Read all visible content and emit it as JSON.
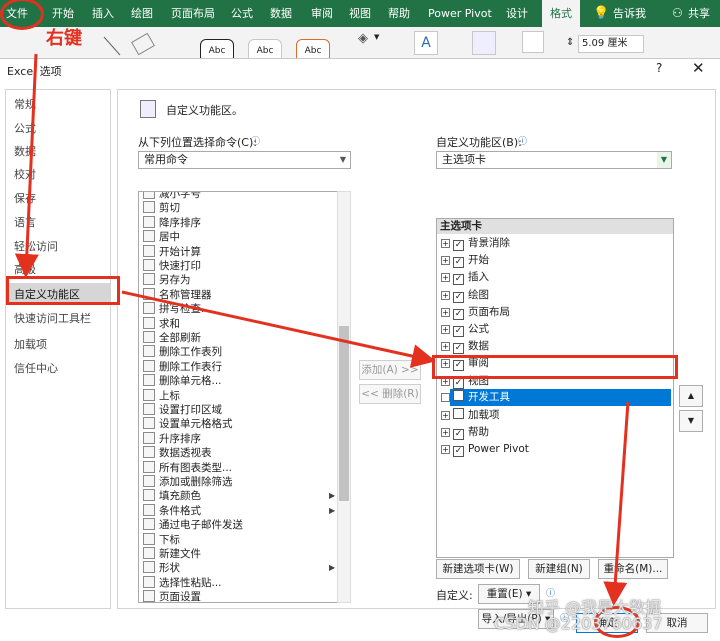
{
  "ribbon": {
    "tabs": [
      "文件",
      "开始",
      "插入",
      "绘图",
      "页面布局",
      "公式",
      "数据",
      "审阅",
      "视图",
      "帮助",
      "Power Pivot",
      "设计",
      "格式"
    ],
    "active_tab": "格式",
    "tell_me": "告诉我",
    "share": "共享",
    "size_value": "5.09 厘米",
    "shape_style_label": "Abc"
  },
  "annotation": {
    "right_click_label": "右键"
  },
  "dialog": {
    "title": "Excel 选项",
    "help": "?",
    "close": "✕",
    "nav": [
      "常规",
      "公式",
      "数据",
      "校对",
      "保存",
      "语言",
      "轻松访问",
      "高级",
      "自定义功能区",
      "快速访问工具栏",
      "加载项",
      "信任中心"
    ],
    "selected_nav": "自定义功能区",
    "header_title": "自定义功能区。",
    "from_label": "从下列位置选择命令(C):",
    "from_value": "常用命令",
    "customize_label": "自定义功能区(B):",
    "customize_value": "主选项卡",
    "commands": [
      {
        "label": "减小字号",
        "arrow": false
      },
      {
        "label": "剪切",
        "arrow": false
      },
      {
        "label": "降序排序",
        "arrow": false
      },
      {
        "label": "居中",
        "arrow": false
      },
      {
        "label": "开始计算",
        "arrow": false
      },
      {
        "label": "快速打印",
        "arrow": false
      },
      {
        "label": "另存为",
        "arrow": false
      },
      {
        "label": "名称管理器",
        "arrow": false
      },
      {
        "label": "拼写检查...",
        "arrow": false
      },
      {
        "label": "求和",
        "arrow": false
      },
      {
        "label": "全部刷新",
        "arrow": false
      },
      {
        "label": "删除工作表列",
        "arrow": false
      },
      {
        "label": "删除工作表行",
        "arrow": false
      },
      {
        "label": "删除单元格...",
        "arrow": false
      },
      {
        "label": "上标",
        "arrow": false
      },
      {
        "label": "设置打印区域",
        "arrow": false
      },
      {
        "label": "设置单元格格式",
        "arrow": false
      },
      {
        "label": "升序排序",
        "arrow": false
      },
      {
        "label": "数据透视表",
        "arrow": false
      },
      {
        "label": "所有图表类型...",
        "arrow": false
      },
      {
        "label": "添加或删除筛选",
        "arrow": false
      },
      {
        "label": "填充颜色",
        "arrow": true
      },
      {
        "label": "条件格式",
        "arrow": true
      },
      {
        "label": "通过电子邮件发送",
        "arrow": false
      },
      {
        "label": "下标",
        "arrow": false
      },
      {
        "label": "新建文件",
        "arrow": false
      },
      {
        "label": "形状",
        "arrow": true
      },
      {
        "label": "选择性粘贴...",
        "arrow": false
      },
      {
        "label": "页面设置",
        "arrow": false
      }
    ],
    "add_button": "添加(A) >>",
    "remove_button": "<< 删除(R)",
    "tree_header": "主选项卡",
    "tree": [
      {
        "label": "背景消除",
        "checked": true
      },
      {
        "label": "开始",
        "checked": true
      },
      {
        "label": "插入",
        "checked": true
      },
      {
        "label": "绘图",
        "checked": true
      },
      {
        "label": "页面布局",
        "checked": true
      },
      {
        "label": "公式",
        "checked": true
      },
      {
        "label": "数据",
        "checked": true
      },
      {
        "label": "审阅",
        "checked": true
      },
      {
        "label": "视图",
        "checked": true
      },
      {
        "label": "开发工具",
        "checked": false
      },
      {
        "label": "加载项",
        "checked": false
      },
      {
        "label": "帮助",
        "checked": true
      },
      {
        "label": "Power Pivot",
        "checked": true
      }
    ],
    "selected_tree_item": "开发工具",
    "new_tab_button": "新建选项卡(W)",
    "new_group_button": "新建组(N)",
    "rename_button": "重命名(M)...",
    "customize_text": "自定义:",
    "reset_button": "重置(E) ▾",
    "import_export_button": "导入/导出(P) ▾",
    "ok_button": "确定",
    "cancel_button": "取消"
  },
  "watermark": {
    "line1": "知乎 @我是大数据",
    "line2": "CSDN @2203760637"
  },
  "colors": {
    "ribbon_green": "#217346",
    "annotation_red": "#e4301e",
    "selection_blue": "#0078d7"
  }
}
